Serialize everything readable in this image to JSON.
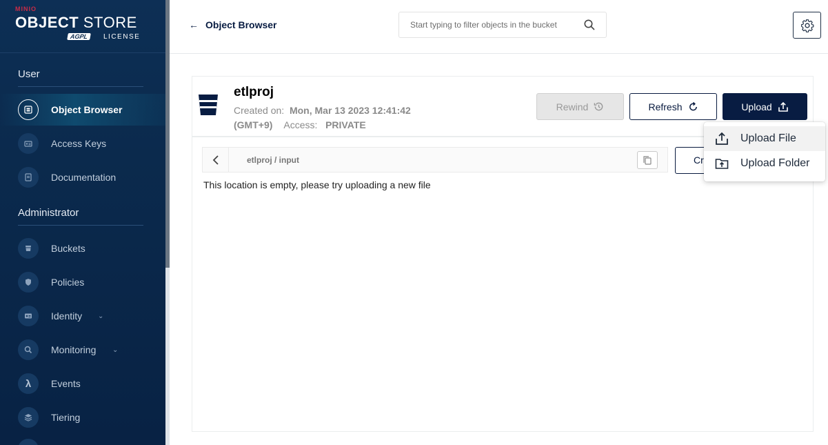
{
  "brand": {
    "minio": "MINIO",
    "title_bold": "OBJECT",
    "title_rest": "STORE",
    "agpl": "AGPL",
    "license": "LICENSE"
  },
  "sidebar": {
    "sections": [
      {
        "label": "User"
      },
      {
        "label": "Administrator"
      }
    ],
    "items": [
      {
        "label": "Object Browser",
        "icon": "object-browser-icon",
        "active": true
      },
      {
        "label": "Access Keys",
        "icon": "access-keys-icon"
      },
      {
        "label": "Documentation",
        "icon": "documentation-icon"
      },
      {
        "label": "Buckets",
        "icon": "buckets-icon"
      },
      {
        "label": "Policies",
        "icon": "policies-icon"
      },
      {
        "label": "Identity",
        "icon": "identity-icon",
        "expandable": true
      },
      {
        "label": "Monitoring",
        "icon": "monitoring-icon",
        "expandable": true
      },
      {
        "label": "Events",
        "icon": "lambda-icon"
      },
      {
        "label": "Tiering",
        "icon": "tiering-icon"
      }
    ]
  },
  "header": {
    "back_label": "Object Browser",
    "search_placeholder": "Start typing to filter objects in the bucket"
  },
  "bucket": {
    "name": "etlproj",
    "created_label": "Created on:",
    "created_value": "Mon, Mar 13 2023 12:41:42",
    "timezone": "(GMT+9)",
    "access_label": "Access:",
    "access_value": "PRIVATE"
  },
  "actions": {
    "rewind": "Rewind",
    "refresh": "Refresh",
    "upload": "Upload",
    "create_partial": "Cr"
  },
  "breadcrumb": {
    "path": "etlproj / input"
  },
  "empty_message": "This location is empty, please try uploading a new file",
  "upload_menu": {
    "items": [
      {
        "label": "Upload File"
      },
      {
        "label": "Upload Folder"
      }
    ]
  },
  "colors": {
    "sidebar_bg": "#0b2a4d",
    "primary": "#081c42",
    "brand_red": "#c72c48"
  }
}
